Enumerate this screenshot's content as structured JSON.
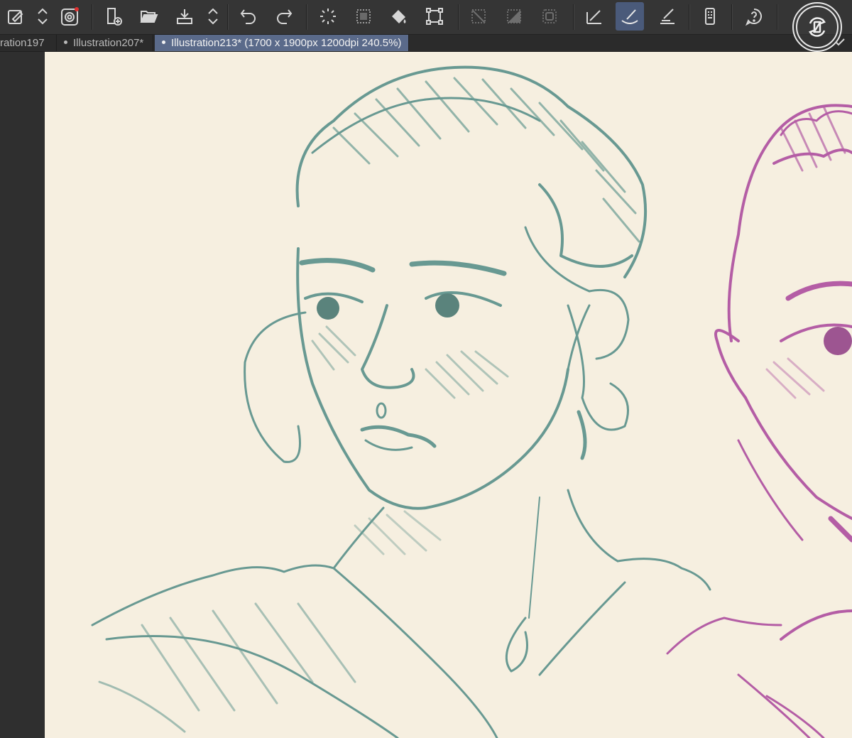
{
  "toolbar": {
    "tools": [
      {
        "name": "eyedropper-layer-icon"
      },
      {
        "name": "scroll-updown-icon"
      },
      {
        "name": "clip-studio-icon",
        "badge_color": "#e03030"
      },
      {
        "name": "new-canvas-icon"
      },
      {
        "name": "open-folder-icon"
      },
      {
        "name": "save-icon"
      },
      {
        "name": "save-options-updown-icon"
      },
      {
        "name": "undo-icon"
      },
      {
        "name": "redo-icon"
      },
      {
        "name": "loading-spinner-icon"
      },
      {
        "name": "select-all-icon"
      },
      {
        "name": "fill-bucket-icon"
      },
      {
        "name": "transform-icon"
      },
      {
        "name": "clear-selection-icon"
      },
      {
        "name": "invert-selection-icon"
      },
      {
        "name": "selection-border-icon"
      },
      {
        "name": "ruler-pen-icon"
      },
      {
        "name": "brush-active-icon",
        "active": true
      },
      {
        "name": "pen-ruler-icon"
      },
      {
        "name": "device-settings-icon"
      },
      {
        "name": "help-icon"
      }
    ]
  },
  "tabs": [
    {
      "label": "ration197",
      "active": false,
      "dot": false
    },
    {
      "label": "Illustration207*",
      "active": false,
      "dot": true
    },
    {
      "label": "Illustration213* (1700 x 1900px 1200dpi 240.5%)",
      "active": true,
      "dot": true
    }
  ],
  "canvas": {
    "background": "#f6efe0",
    "sketch_primary_color": "#4f8a84",
    "sketch_secondary_color": "#a8449a"
  },
  "widgets": {
    "rotate_icon": "rotate-canvas-icon",
    "confirm_icon": "check-icon"
  },
  "theme": {
    "toolbar_bg": "#353535",
    "tab_active_bg": "#5a6a8a",
    "icon_color": "#d6d6d6"
  }
}
